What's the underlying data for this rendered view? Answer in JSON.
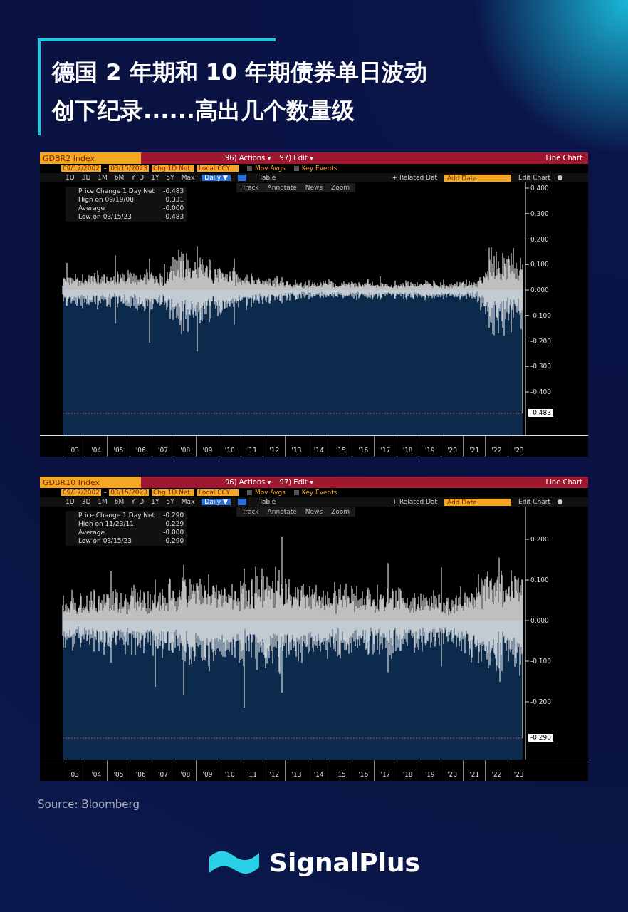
{
  "title": {
    "lines": [
      "德国 2 年期和 10 年期债券单日波动",
      "创下纪录......高出几个数量级"
    ]
  },
  "charts": [
    {
      "ticker": "GDBR2 Index",
      "actions": "96) Actions ▾",
      "edit": "97) Edit ▾",
      "view": "Line Chart",
      "start_date": "09/17/2002",
      "date_separator": "-",
      "end_date": "03/15/2023",
      "field": "Chg 1D Net",
      "currency": "Local CCY",
      "options": [
        {
          "label": "Mov Avgs",
          "checked": false
        },
        {
          "label": "Key Events",
          "checked": false
        }
      ],
      "periods": [
        {
          "label": "1D",
          "selected": false
        },
        {
          "label": "3D",
          "selected": false
        },
        {
          "label": "1M",
          "selected": false
        },
        {
          "label": "6M",
          "selected": false
        },
        {
          "label": "YTD",
          "selected": false
        },
        {
          "label": "1Y",
          "selected": false
        },
        {
          "label": "5Y",
          "selected": false
        },
        {
          "label": "Max",
          "selected": false
        },
        {
          "label": "Daily ▼",
          "selected": true
        }
      ],
      "table": "Table",
      "related": "+ Related Dat",
      "add_data": {
        "placeholder": "Add Data"
      },
      "edit_chart": "Edit Chart",
      "tools": [
        "Track",
        "Annotate",
        "News",
        "Zoom"
      ],
      "legend": [
        {
          "label": "Price Change 1 Day Net",
          "value": "-0.483"
        },
        {
          "label": "High on 09/19/08",
          "value": "0.331"
        },
        {
          "label": "Average",
          "value": "-0.000"
        },
        {
          "label": "Low on 03/15/23",
          "value": "-0.483"
        }
      ],
      "y_labels": [
        "0.400",
        "0.300",
        "0.200",
        "0.100",
        "0.000",
        "-0.100",
        "-0.200",
        "-0.300",
        "-0.400"
      ],
      "last_value": "-0.483",
      "x_labels": [
        "'03",
        "'04",
        "'05",
        "'06",
        "'07",
        "'08",
        "'09",
        "'10",
        "'11",
        "'12",
        "'13",
        "'14",
        "'15",
        "'16",
        "'17",
        "'18",
        "'19",
        "'20",
        "'21",
        "'22",
        "'23"
      ]
    },
    {
      "ticker": "GDBR10 Index",
      "actions": "96) Actions ▾",
      "edit": "97) Edit ▾",
      "view": "Line Chart",
      "start_date": "09/17/2002",
      "date_separator": "-",
      "end_date": "03/15/2023",
      "field": "Chg 1D Net",
      "currency": "Local CCY",
      "options": [
        {
          "label": "Mov Avgs",
          "checked": false
        },
        {
          "label": "Key Events",
          "checked": false
        }
      ],
      "periods": [
        {
          "label": "1D",
          "selected": false
        },
        {
          "label": "3D",
          "selected": false
        },
        {
          "label": "1M",
          "selected": false
        },
        {
          "label": "6M",
          "selected": false
        },
        {
          "label": "YTD",
          "selected": false
        },
        {
          "label": "1Y",
          "selected": false
        },
        {
          "label": "5Y",
          "selected": false
        },
        {
          "label": "Max",
          "selected": false
        },
        {
          "label": "Daily ▼",
          "selected": true
        }
      ],
      "table": "Table",
      "related": "+ Related Dat",
      "add_data": {
        "placeholder": "Add Data"
      },
      "edit_chart": "Edit Chart",
      "tools": [
        "Track",
        "Annotate",
        "News",
        "Zoom"
      ],
      "legend": [
        {
          "label": "Price Change 1 Day Net",
          "value": "-0.290"
        },
        {
          "label": "High on 11/23/11",
          "value": "0.229"
        },
        {
          "label": "Average",
          "value": "-0.000"
        },
        {
          "label": "Low on 03/15/23",
          "value": "-0.290"
        }
      ],
      "y_labels": [
        "0.200",
        "0.100",
        "0.000",
        "-0.100",
        "-0.200"
      ],
      "last_value": "-0.290",
      "x_labels": [
        "'03",
        "'04",
        "'05",
        "'06",
        "'07",
        "'08",
        "'09",
        "'10",
        "'11",
        "'12",
        "'13",
        "'14",
        "'15",
        "'16",
        "'17",
        "'18",
        "'19",
        "'20",
        "'21",
        "'22",
        "'23"
      ]
    }
  ],
  "source": "Source: Bloomberg",
  "brand": "SignalPlus"
}
